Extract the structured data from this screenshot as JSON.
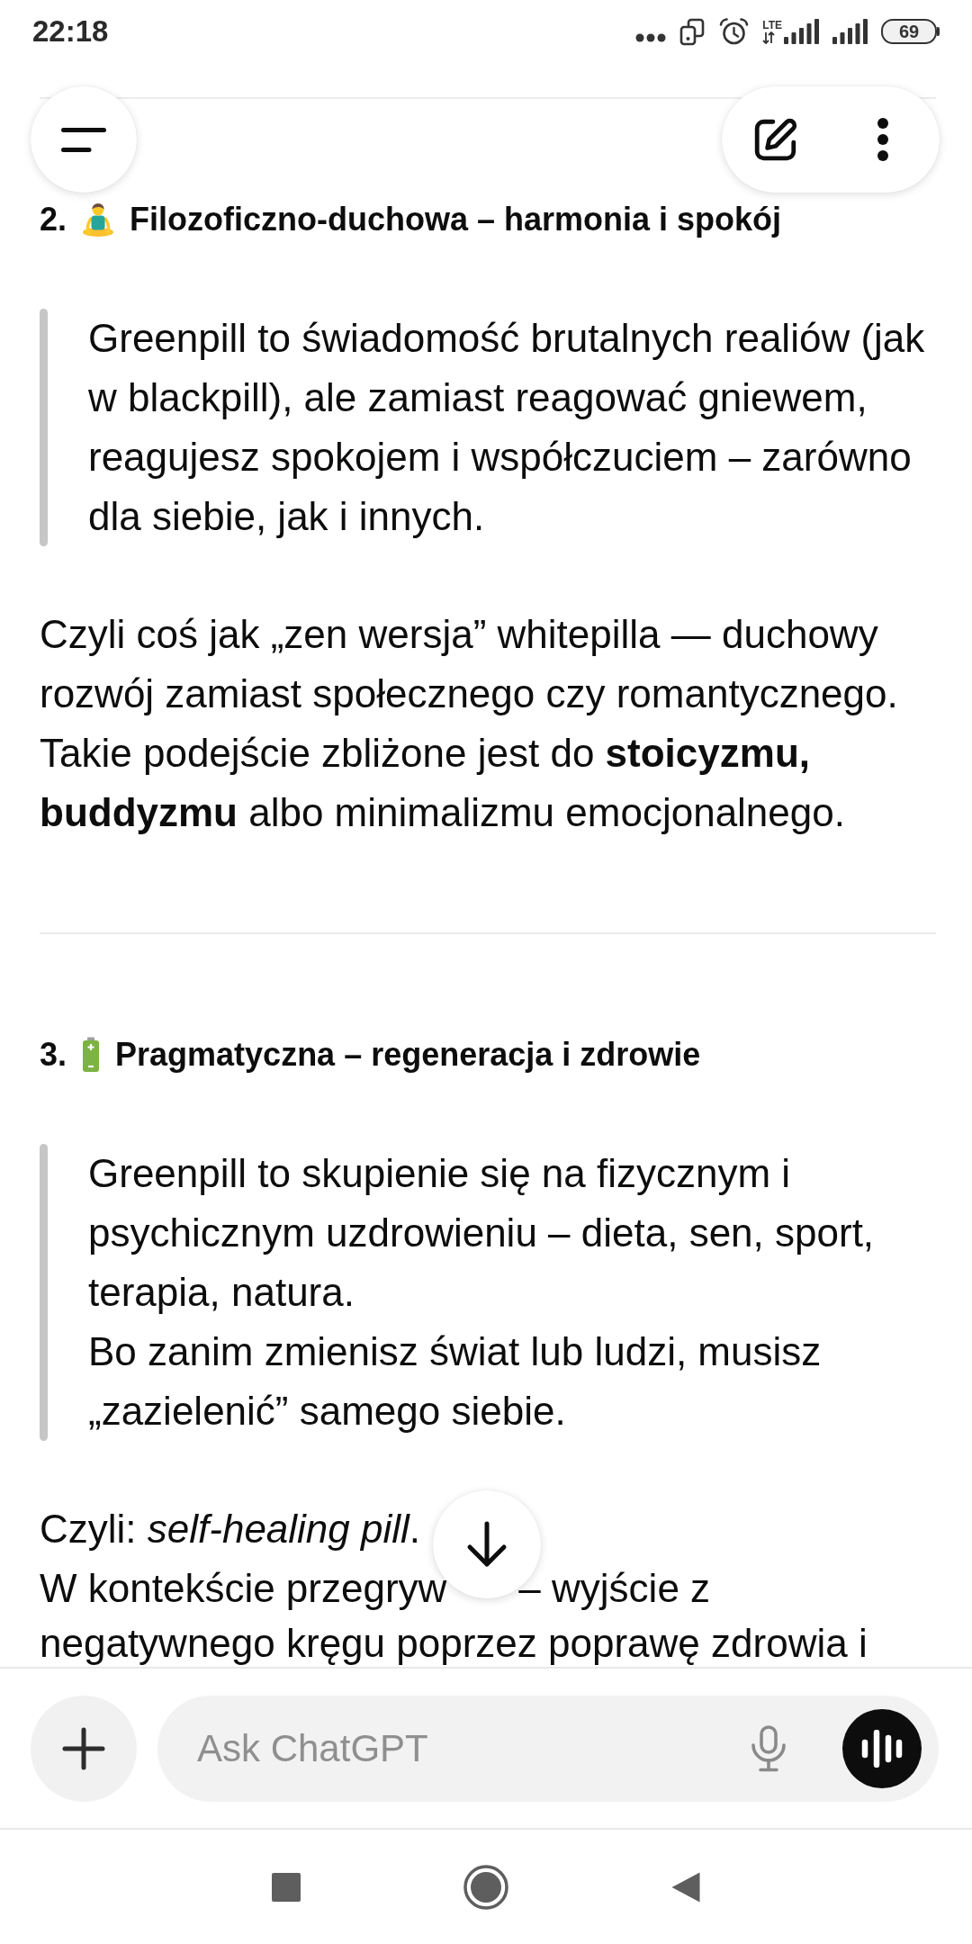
{
  "status_bar": {
    "time": "22:18",
    "network_type": "LTE",
    "battery": "69"
  },
  "sections": [
    {
      "number": "2.",
      "kind": "meditation",
      "title": "Filozoficzno-duchowa – harmonia i spokój",
      "quote": [
        "Greenpill to świadomość brutalnych realiów (jak w blackpill), ale zamiast reagować gniewem, reagujesz spokojem i współczuciem – zarówno dla siebie, jak i innych."
      ],
      "paragraphs": [
        {
          "lines": [
            [
              "Czyli coś jak „zen wersja” whitepilla — duchowy rozwój zamiast społecznego czy romantycznego. Takie podejście zbliżone jest do **stoicyzmu, buddyzmu** albo minimalizmu emocjonalnego."
            ]
          ]
        }
      ]
    },
    {
      "number": "3.",
      "kind": "battery",
      "title": "Pragmatyczna – regeneracja i zdrowie",
      "quote": [
        "Greenpill to skupienie się na fizycznym i psychicznym uzdrowieniu – dieta, sen, sport, terapia, natura.",
        "Bo zanim zmienisz świat lub ludzi, musisz „zazielenić” samego siebie."
      ],
      "paragraphs": [
        {
          "lines": [
            [
              "Czyli: *self-healing pill*."
            ],
            [
              "W kontekście przegryw",
              "– wyjście z"
            ],
            [
              "negatywnego kręgu poprzez poprawę zdrowia i"
            ]
          ]
        }
      ]
    }
  ],
  "composer": {
    "placeholder": "Ask ChatGPT"
  }
}
